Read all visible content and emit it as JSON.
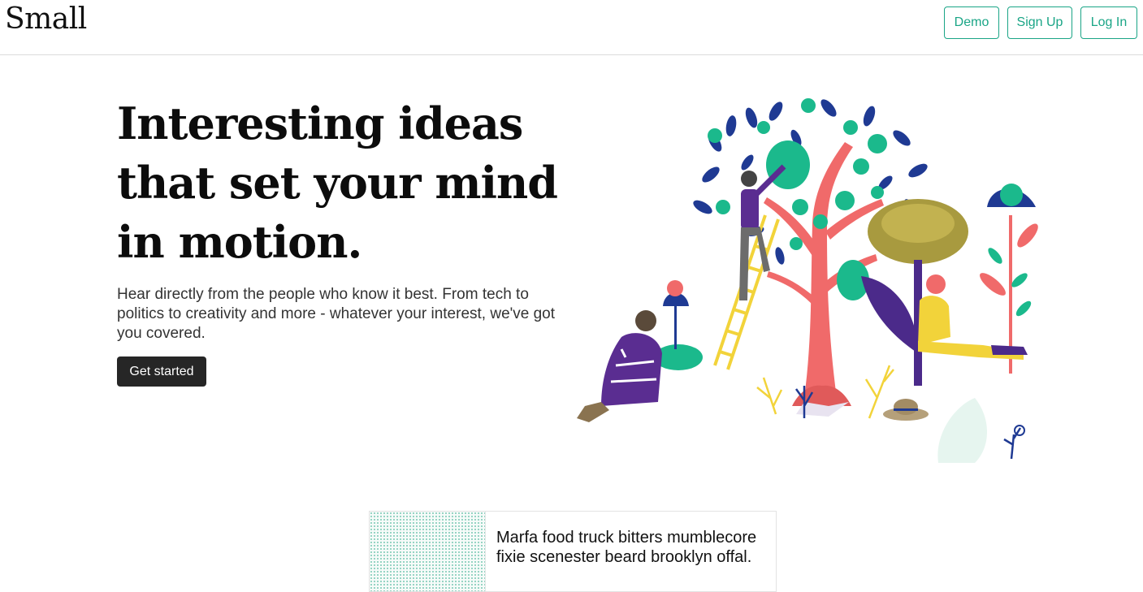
{
  "header": {
    "brand": "Small",
    "buttons": {
      "demo": "Demo",
      "signup": "Sign Up",
      "login": "Log In"
    },
    "accent_color": "#1aa586"
  },
  "hero": {
    "title": "Interesting ideas that set your mind in motion.",
    "subtitle": "Hear directly from the people who know it best. From tech to politics to creativity and more - whatever your interest, we've got you covered.",
    "cta_label": "Get started",
    "illustration": "people-among-trees-illustration"
  },
  "feed": {
    "cards": [
      {
        "title": "Marfa food truck bitters mumblecore fixie scenester beard brooklyn offal."
      }
    ]
  }
}
